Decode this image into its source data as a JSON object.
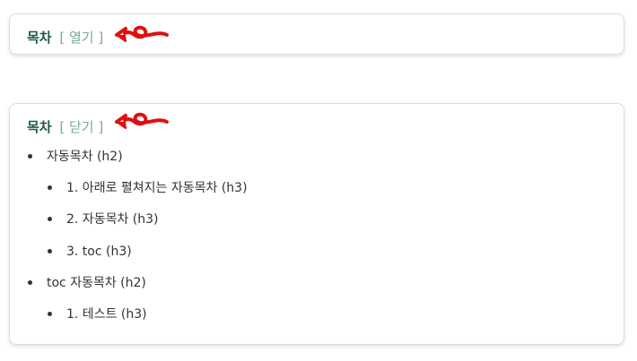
{
  "collapsed_toc": {
    "title": "목차",
    "toggle": "[ 열기 ]"
  },
  "expanded_toc": {
    "title": "목차",
    "toggle": "[ 닫기 ]",
    "items": [
      {
        "level": 2,
        "label": "자동목차 (h2)"
      },
      {
        "level": 3,
        "label": "1. 아래로 펼쳐지는 자동목차 (h3)"
      },
      {
        "level": 3,
        "label": "2. 자동목차 (h3)"
      },
      {
        "level": 3,
        "label": "3. toc (h3)"
      },
      {
        "level": 2,
        "label": "toc 자동목차 (h2)"
      },
      {
        "level": 3,
        "label": "1. 테스트 (h3)"
      }
    ]
  },
  "annotation": {
    "icon": "red-arrow-icon",
    "color": "#e01010"
  },
  "colors": {
    "title": "#1e5a46",
    "toggle": "#7aa89a",
    "text": "#333333",
    "border": "#d9dde3"
  }
}
